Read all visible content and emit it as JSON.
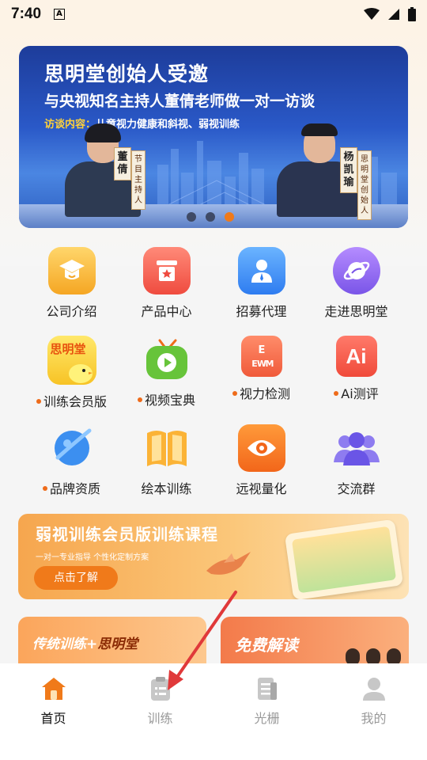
{
  "status_bar": {
    "time": "7:40",
    "notification_icon": "A"
  },
  "banner": {
    "title": "思明堂创始人受邀",
    "subtitle": "与央视知名主持人董倩老师做一对一访谈",
    "topic_label": "访谈内容：",
    "topic": "儿童视力健康和斜视、弱视训练",
    "host_name": "董倩",
    "host_role": "节目主持人",
    "guest_name": "杨凯瑜",
    "guest_role": "思明堂创始人",
    "page_count": 3,
    "active_page": 3
  },
  "grid": [
    {
      "label": "公司介绍",
      "icon": "graduation-cap-icon",
      "bullet": false
    },
    {
      "label": "产品中心",
      "icon": "product-box-icon",
      "bullet": false
    },
    {
      "label": "招募代理",
      "icon": "agent-person-icon",
      "bullet": false
    },
    {
      "label": "走进思明堂",
      "icon": "planet-icon",
      "bullet": false
    },
    {
      "label": "训练会员版",
      "icon": "simingtang-chick-icon",
      "icon_text": "思明堂",
      "bullet": true
    },
    {
      "label": "视频宝典",
      "icon": "video-tv-icon",
      "bullet": true
    },
    {
      "label": "视力检测",
      "icon": "eye-chart-icon",
      "bullet": true
    },
    {
      "label": "Ai测评",
      "icon": "ai-icon",
      "icon_text": "Ai",
      "bullet": true
    },
    {
      "label": "品牌资质",
      "icon": "brand-planet-icon",
      "bullet": true
    },
    {
      "label": "绘本训练",
      "icon": "picture-book-icon",
      "bullet": false
    },
    {
      "label": "远视量化",
      "icon": "eye-icon",
      "bullet": false
    },
    {
      "label": "交流群",
      "icon": "group-icon",
      "bullet": false
    }
  ],
  "promo": {
    "title": "弱视训练会员版训练课程",
    "subtitle": "一对一专业指导 个性化定制方案",
    "button": "点击了解"
  },
  "cards": {
    "left_title_a": "传统训练",
    "left_title_plus": "+",
    "left_title_b": "思明堂",
    "right_title": "免费解读"
  },
  "tabbar": [
    {
      "label": "首页",
      "icon": "home-icon",
      "active": true
    },
    {
      "label": "训练",
      "icon": "training-clipboard-icon",
      "active": false
    },
    {
      "label": "光栅",
      "icon": "grating-doc-icon",
      "active": false
    },
    {
      "label": "我的",
      "icon": "profile-icon",
      "active": false
    }
  ],
  "colors": {
    "accent": "#f07a1a",
    "tab_active": "#111111",
    "tab_inactive": "#9a9a9a"
  }
}
